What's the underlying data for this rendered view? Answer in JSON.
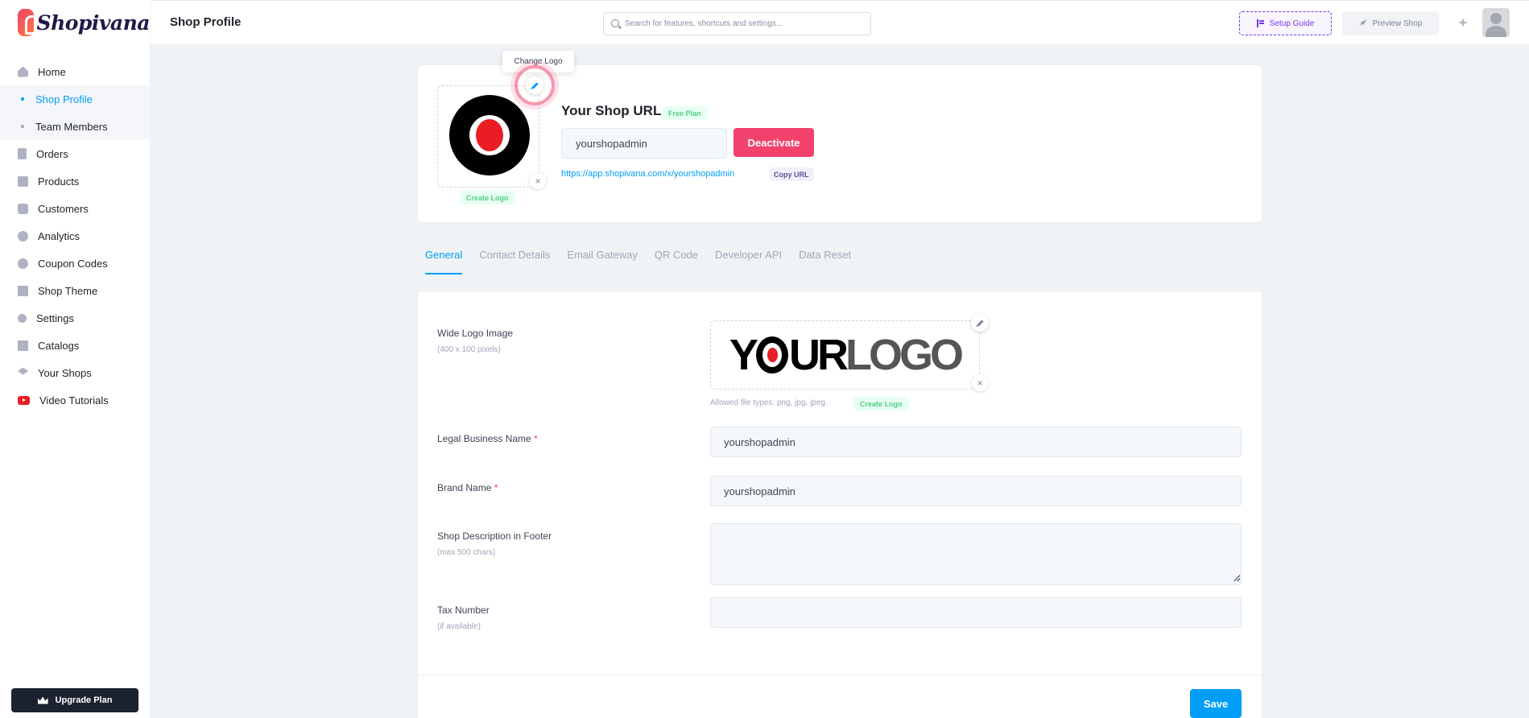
{
  "brand": {
    "name": "Shopivana"
  },
  "header": {
    "title": "Shop Profile",
    "search_placeholder": "Search for features, shortcuts and settings...",
    "setup_guide": "Setup Guide",
    "preview_shop": "Preview Shop"
  },
  "sidebar": {
    "items": [
      {
        "label": "Home",
        "icon": "home-icon"
      },
      {
        "label": "Shop Profile",
        "icon": "dot",
        "active": true
      },
      {
        "label": "Team Members",
        "icon": "dot"
      },
      {
        "label": "Orders",
        "icon": "clipboard-icon"
      },
      {
        "label": "Products",
        "icon": "products-icon"
      },
      {
        "label": "Customers",
        "icon": "customer-icon"
      },
      {
        "label": "Analytics",
        "icon": "pie-chart-icon"
      },
      {
        "label": "Coupon Codes",
        "icon": "percent-icon"
      },
      {
        "label": "Shop Theme",
        "icon": "layout-icon"
      },
      {
        "label": "Settings",
        "icon": "gear-icon"
      },
      {
        "label": "Catalogs",
        "icon": "catalog-icon"
      },
      {
        "label": "Your Shops",
        "icon": "layers-icon"
      },
      {
        "label": "Video Tutorials",
        "icon": "youtube-icon"
      }
    ],
    "upgrade_label": "Upgrade Plan"
  },
  "shop_card": {
    "tooltip": "Change Logo",
    "create_logo": "Create Logo",
    "title": "Your Shop URL",
    "plan_badge": "Free Plan",
    "url_value": "yourshopadmin",
    "deactivate": "Deactivate",
    "link": "https://app.shopivana.com/x/yourshopadmin",
    "copy_url": "Copy URL"
  },
  "tabs": [
    "General",
    "Contact Details",
    "Email Gateway",
    "QR Code",
    "Developer API",
    "Data Reset"
  ],
  "active_tab": "General",
  "form": {
    "wide_logo_label": "Wide Logo Image",
    "wide_logo_hint": "(400 x 100 pixels)",
    "wide_logo_text_1": "Y",
    "wide_logo_text_2": "UR",
    "wide_logo_text_3": "LOGO",
    "allowed_types": "Allowed file types: png, jpg, jpeg.",
    "create_logo": "Create Logo",
    "legal_name_label": "Legal Business Name",
    "legal_name_value": "yourshopadmin",
    "brand_name_label": "Brand Name",
    "brand_name_value": "yourshopadmin",
    "description_label": "Shop Description in Footer",
    "description_hint": "(max 500 chars)",
    "description_value": "",
    "tax_label": "Tax Number",
    "tax_hint": "(if available)",
    "tax_value": "",
    "required_mark": "*",
    "save": "Save"
  },
  "colors": {
    "accent": "#009ef7",
    "danger": "#f1416c",
    "success": "#50cd89",
    "purple": "#7239ea",
    "sidebar_dark": "#1c2230"
  }
}
